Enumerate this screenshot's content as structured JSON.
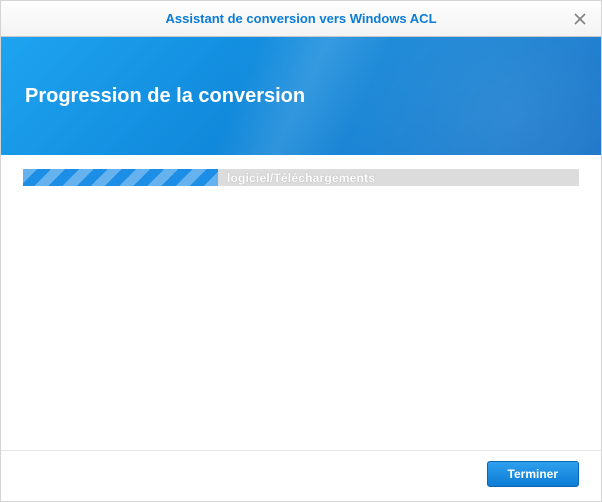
{
  "titlebar": {
    "title": "Assistant de conversion vers Windows ACL"
  },
  "banner": {
    "heading": "Progression de la conversion"
  },
  "progress": {
    "percent": 35,
    "label": "logiciel/Téléchargements"
  },
  "footer": {
    "finish_label": "Terminer"
  },
  "colors": {
    "accent": "#0d82d6",
    "progress_fill": "#1c8ee6"
  }
}
